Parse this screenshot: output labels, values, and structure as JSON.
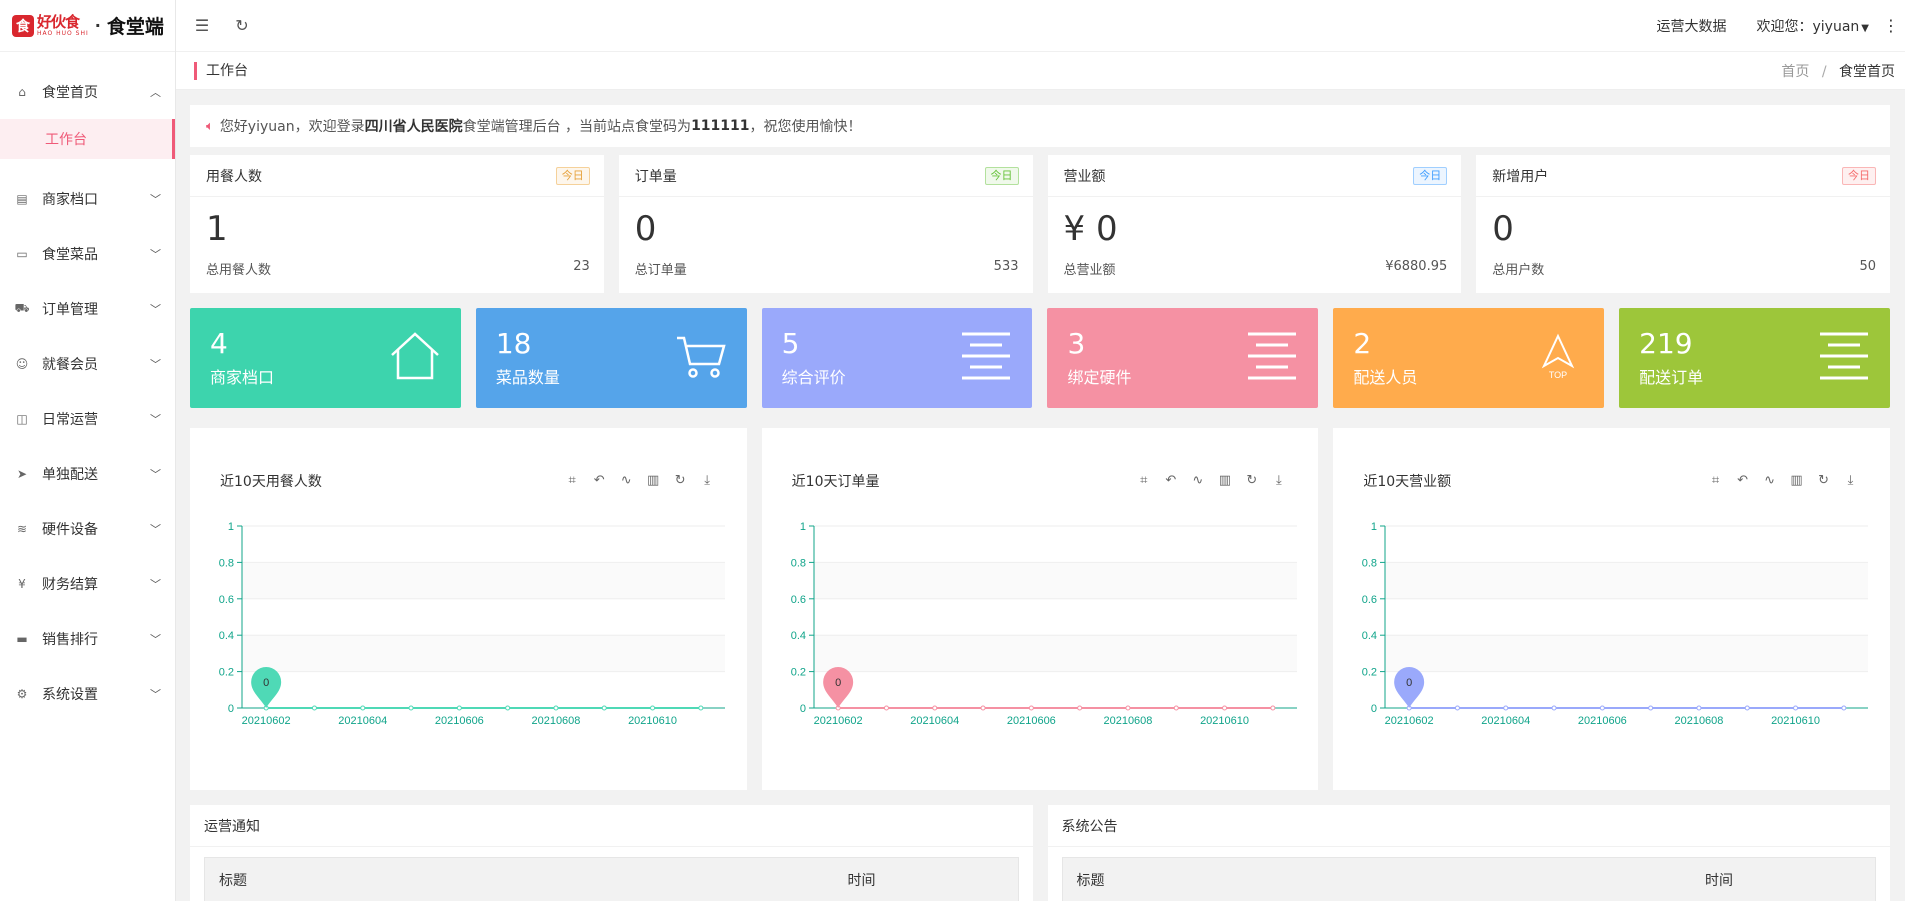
{
  "app": {
    "brand_cn": "好伙食",
    "brand_pinyin": "HAO HUO SHI",
    "brand_sep": "·",
    "brand_sub": "食堂端"
  },
  "topbar": {
    "big_data_link": "运营大数据",
    "user_greeting": "欢迎您：yiyuan"
  },
  "breadcrumb": {
    "page_title": "工作台",
    "items": [
      "首页",
      "食堂首页"
    ],
    "sep": "/"
  },
  "sidebar": {
    "items": [
      {
        "label": "食堂首页",
        "icon": "home-icon",
        "expanded": true
      },
      {
        "label": "商家档口",
        "icon": "store-icon"
      },
      {
        "label": "食堂菜品",
        "icon": "image-icon"
      },
      {
        "label": "订单管理",
        "icon": "cart-icon"
      },
      {
        "label": "就餐会员",
        "icon": "users-icon"
      },
      {
        "label": "日常运营",
        "icon": "gift-icon"
      },
      {
        "label": "单独配送",
        "icon": "send-icon"
      },
      {
        "label": "硬件设备",
        "icon": "wifi-icon"
      },
      {
        "label": "财务结算",
        "icon": "yen-icon"
      },
      {
        "label": "销售排行",
        "icon": "monitor-icon"
      },
      {
        "label": "系统设置",
        "icon": "settings-icon"
      }
    ],
    "active_sub": "工作台"
  },
  "welcome": {
    "p1": "您好yiyuan，欢迎登录 ",
    "hospital": "四川省人民医院",
    "p2": "食堂端管理后台 ，当前站点食堂码为 ",
    "code": "111111",
    "p3": " ，祝您使用愉快！"
  },
  "stats": [
    {
      "title": "用餐人数",
      "badge": "今日",
      "badge_color": "#e6a23c",
      "value": "1",
      "foot_label": "总用餐人数",
      "foot_value": "23"
    },
    {
      "title": "订单量",
      "badge": "今日",
      "badge_color": "#67c23a",
      "value": "0",
      "foot_label": "总订单量",
      "foot_value": "533"
    },
    {
      "title": "营业额",
      "badge": "今日",
      "badge_color": "#409eff",
      "value": "¥ 0",
      "foot_label": "总营业额",
      "foot_value": "¥6880.95"
    },
    {
      "title": "新增用户",
      "badge": "今日",
      "badge_color": "#f56c6c",
      "value": "0",
      "foot_label": "总用户数",
      "foot_value": "50"
    }
  ],
  "tiles": [
    {
      "value": "4",
      "label": "商家档口",
      "color": "#3dd4ad",
      "icon": "house-icon"
    },
    {
      "value": "18",
      "label": "菜品数量",
      "color": "#55a4ea",
      "icon": "cart-icon"
    },
    {
      "value": "5",
      "label": "综合评价",
      "color": "#9aa9fb",
      "icon": "lines-icon"
    },
    {
      "value": "3",
      "label": "绑定硬件",
      "color": "#f591a3",
      "icon": "lines-icon"
    },
    {
      "value": "2",
      "label": "配送人员",
      "color": "#ffab4c",
      "icon": "top-arrow-icon",
      "icon_text": "TOP"
    },
    {
      "value": "219",
      "label": "配送订单",
      "color": "#9dc63a",
      "icon": "lines-icon"
    }
  ],
  "chart_data": [
    {
      "type": "line",
      "title": "近10天用餐人数",
      "x": [
        "20210602",
        "20210603",
        "20210604",
        "20210605",
        "20210606",
        "20210607",
        "20210608",
        "20210609",
        "20210610",
        "20210611"
      ],
      "xticks": [
        "20210602",
        "20210604",
        "20210606",
        "20210608",
        "20210610"
      ],
      "series": [
        {
          "values": [
            0,
            0,
            0,
            0,
            0,
            0,
            0,
            0,
            0,
            0
          ]
        }
      ],
      "ylim": [
        0,
        1
      ],
      "yticks": [
        "0",
        "0.2",
        "0.4",
        "0.6",
        "0.8",
        "1"
      ],
      "marker_label": "0",
      "color": "#4fd9b6",
      "axis_color": "#10a48a"
    },
    {
      "type": "line",
      "title": "近10天订单量",
      "x": [
        "20210602",
        "20210603",
        "20210604",
        "20210605",
        "20210606",
        "20210607",
        "20210608",
        "20210609",
        "20210610",
        "20210611"
      ],
      "xticks": [
        "20210602",
        "20210604",
        "20210606",
        "20210608",
        "20210610"
      ],
      "series": [
        {
          "values": [
            0,
            0,
            0,
            0,
            0,
            0,
            0,
            0,
            0,
            0
          ]
        }
      ],
      "ylim": [
        0,
        1
      ],
      "yticks": [
        "0",
        "0.2",
        "0.4",
        "0.6",
        "0.8",
        "1"
      ],
      "marker_label": "0",
      "color": "#f591a3",
      "axis_color": "#10a48a"
    },
    {
      "type": "line",
      "title": "近10天营业额",
      "x": [
        "20210602",
        "20210603",
        "20210604",
        "20210605",
        "20210606",
        "20210607",
        "20210608",
        "20210609",
        "20210610",
        "20210611"
      ],
      "xticks": [
        "20210602",
        "20210604",
        "20210606",
        "20210608",
        "20210610"
      ],
      "series": [
        {
          "values": [
            0,
            0,
            0,
            0,
            0,
            0,
            0,
            0,
            0,
            0
          ]
        }
      ],
      "ylim": [
        0,
        1
      ],
      "yticks": [
        "0",
        "0.2",
        "0.4",
        "0.6",
        "0.8",
        "1"
      ],
      "marker_label": "0",
      "color": "#9aa9fb",
      "axis_color": "#10a48a"
    }
  ],
  "notices": [
    {
      "title": "运营通知",
      "col_title": "标题",
      "col_time": "时间"
    },
    {
      "title": "系统公告",
      "col_title": "标题",
      "col_time": "时间"
    }
  ]
}
